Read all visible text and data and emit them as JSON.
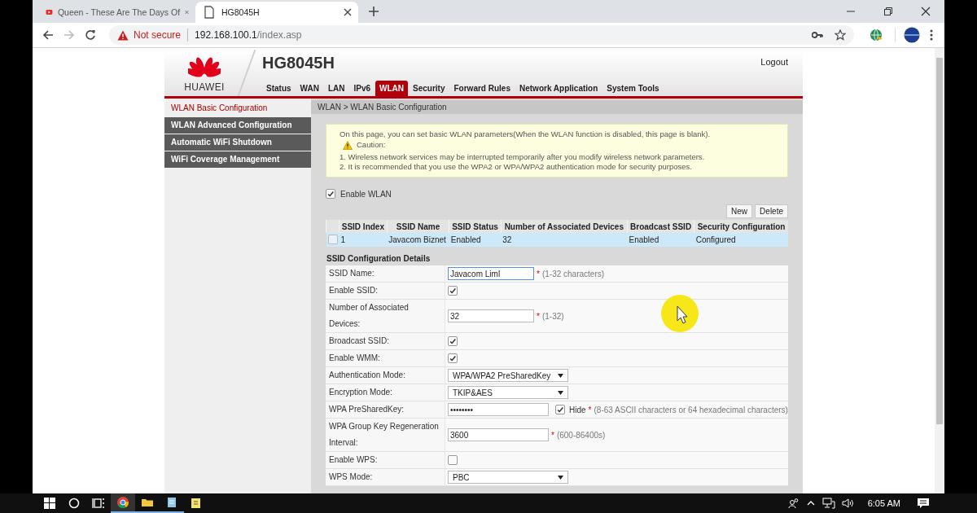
{
  "browser": {
    "tabs": [
      {
        "title": "Queen - These Are The Days Of",
        "kind": "video",
        "selected": false
      },
      {
        "title": "HG8045H",
        "kind": "page",
        "selected": true
      }
    ],
    "security": "Not secure",
    "host": "192.168.100.1",
    "path": "/index.asp"
  },
  "router": {
    "brand": "HUAWEI",
    "model": "HG8045H",
    "logout": "Logout",
    "nav": [
      {
        "label": "Status",
        "selected": false
      },
      {
        "label": "WAN",
        "selected": false
      },
      {
        "label": "LAN",
        "selected": false
      },
      {
        "label": "IPv6",
        "selected": false
      },
      {
        "label": "WLAN",
        "selected": true
      },
      {
        "label": "Security",
        "selected": false
      },
      {
        "label": "Forward Rules",
        "selected": false
      },
      {
        "label": "Network Application",
        "selected": false
      },
      {
        "label": "System Tools",
        "selected": false
      }
    ],
    "sidebar": [
      {
        "label": "WLAN Basic Configuration",
        "selected": true
      },
      {
        "label": "WLAN Advanced Configuration",
        "selected": false
      },
      {
        "label": "Automatic WiFi Shutdown",
        "selected": false
      },
      {
        "label": "WiFi Coverage Management",
        "selected": false
      }
    ],
    "breadcrumb": "WLAN > WLAN Basic Configuration",
    "notice": {
      "intro": "On this page, you can set basic WLAN parameters(When the WLAN function is disabled, this page is blank).",
      "caution": "Caution:",
      "items": [
        "1. Wireless network services may be interrupted temporarily after you modify wireless network parameters.",
        "2. It is recommended that you use the WPA2 or WPA/WPA2 authentication mode for security purposes."
      ]
    },
    "enable_wlan": {
      "label": "Enable WLAN",
      "checked": true
    },
    "buttons": [
      "New",
      "Delete"
    ],
    "table": {
      "columns": [
        "SSID Index",
        "SSID Name",
        "SSID Status",
        "Number of Associated Devices",
        "Broadcast SSID",
        "Security Configuration"
      ],
      "rows": [
        {
          "checked": false,
          "selected": true,
          "cells": [
            "1",
            "Javacom Biznet",
            "Enabled",
            "32",
            "Enabled",
            "Configured"
          ]
        }
      ]
    },
    "details": {
      "title": "SSID Configuration Details",
      "rows": [
        {
          "kind": "text",
          "label": "SSID Name:",
          "value": "Javacom Liml",
          "focused": true,
          "mark": "*",
          "hint": "(1-32 characters)"
        },
        {
          "kind": "checkbox",
          "label": "Enable SSID:",
          "checked": true
        },
        {
          "kind": "text",
          "label": "Number of Associated Devices:",
          "value": "32",
          "focused": false,
          "mark": "*",
          "hint": "(1-32)"
        },
        {
          "kind": "checkbox",
          "label": "Broadcast SSID:",
          "checked": true
        },
        {
          "kind": "checkbox",
          "label": "Enable WMM:",
          "checked": true
        },
        {
          "kind": "select",
          "label": "Authentication Mode:",
          "value": "WPA/WPA2 PreSharedKey"
        },
        {
          "kind": "select",
          "label": "Encryption Mode:",
          "value": "TKIP&AES"
        },
        {
          "kind": "password",
          "label": "WPA PreSharedKey:",
          "value": "••••••••",
          "hide": {
            "label": "Hide",
            "checked": true
          },
          "mark": "*",
          "hint": "(8-63 ASCII characters or 64 hexadecimal characters)"
        },
        {
          "kind": "text",
          "label": "WPA Group Key Regeneration Interval:",
          "value": "3600",
          "focused": false,
          "mark": "*",
          "hint": "(600-86400s)"
        },
        {
          "kind": "checkbox",
          "label": "Enable WPS:",
          "checked": false
        },
        {
          "kind": "select",
          "label": "WPS Mode:",
          "value": "PBC"
        }
      ]
    }
  },
  "taskbar": {
    "time": "6:05 AM"
  }
}
